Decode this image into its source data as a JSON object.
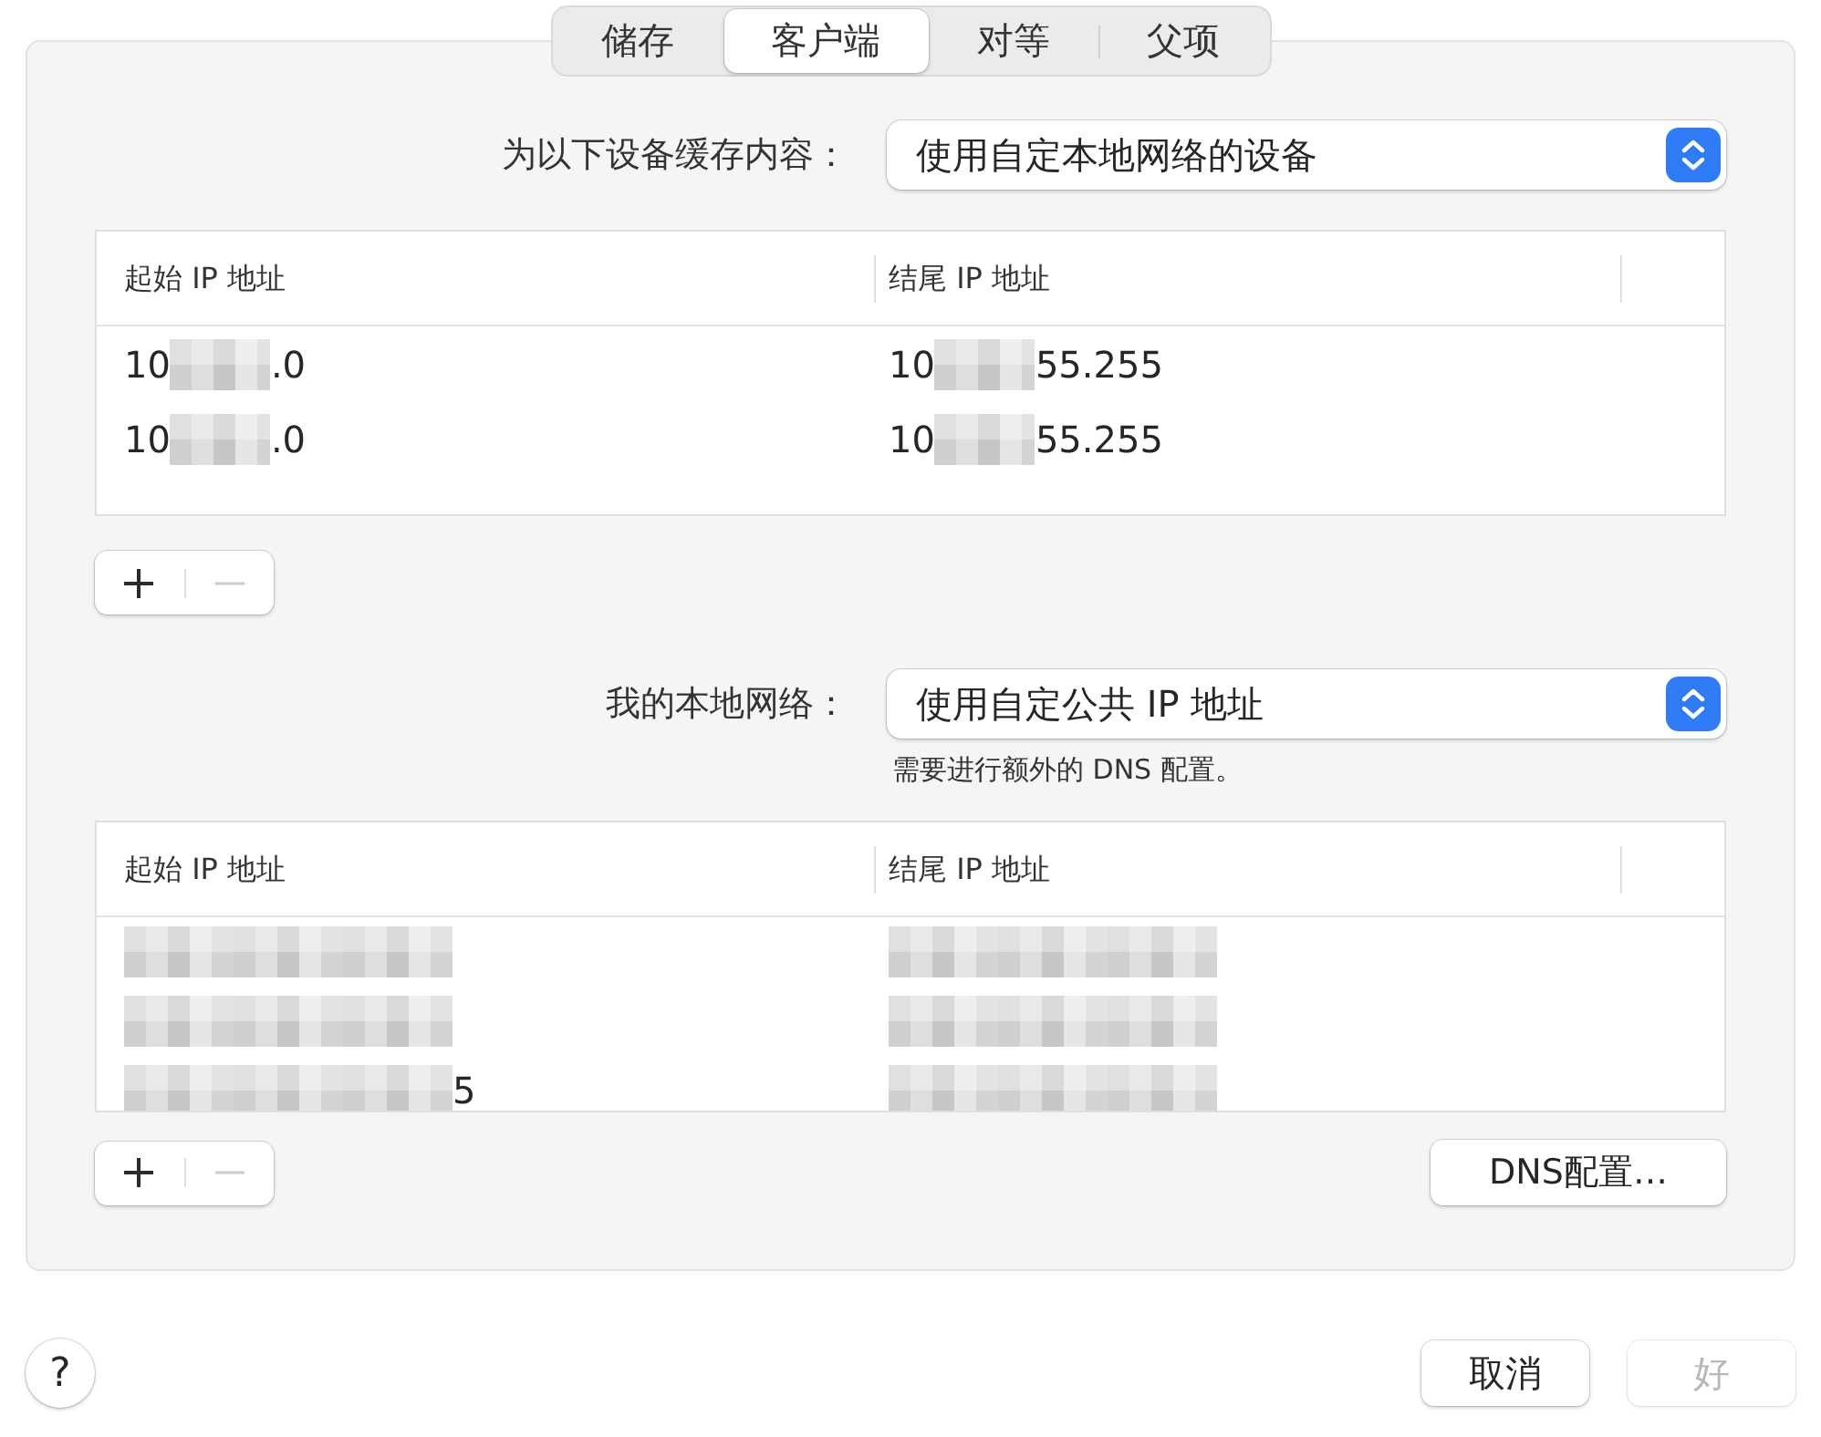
{
  "tabs": [
    {
      "label": "储存",
      "selected": false
    },
    {
      "label": "客户端",
      "selected": true
    },
    {
      "label": "对等",
      "selected": false
    },
    {
      "label": "父项",
      "selected": false
    }
  ],
  "cache_for": {
    "label": "为以下设备缓存内容：",
    "value": "使用自定本地网络的设备"
  },
  "client_ranges": {
    "columns": [
      "起始 IP 地址",
      "结尾 IP 地址"
    ],
    "rows": [
      [
        {
          "before": "10",
          "redacted": true,
          "after": ".0"
        },
        {
          "before": "10",
          "redacted": true,
          "after": "55.255"
        }
      ],
      [
        {
          "before": "10",
          "redacted": true,
          "after": ".0"
        },
        {
          "before": "10",
          "redacted": true,
          "after": "55.255"
        }
      ]
    ],
    "buttons": [
      {
        "kind": "add",
        "disabled": false
      },
      {
        "kind": "remove",
        "disabled": true
      }
    ]
  },
  "local_network": {
    "label": "我的本地网络：",
    "value": "使用自定公共 IP 地址",
    "note": "需要进行额外的 DNS 配置。"
  },
  "public_ranges": {
    "columns": [
      "起始 IP 地址",
      "结尾 IP 地址"
    ],
    "rows": [
      [
        {
          "redacted": true
        },
        {
          "redacted": true
        }
      ],
      [
        {
          "redacted": true
        },
        {
          "redacted": true
        }
      ],
      [
        {
          "redacted": true,
          "after": "5"
        },
        {
          "redacted": true
        }
      ]
    ],
    "buttons": [
      {
        "kind": "add",
        "disabled": false
      },
      {
        "kind": "remove",
        "disabled": true
      }
    ],
    "dns_button": "DNS配置…"
  },
  "help_button": "?",
  "footer_buttons": [
    {
      "label": "取消",
      "disabled": false
    },
    {
      "label": "好",
      "disabled": true
    }
  ]
}
